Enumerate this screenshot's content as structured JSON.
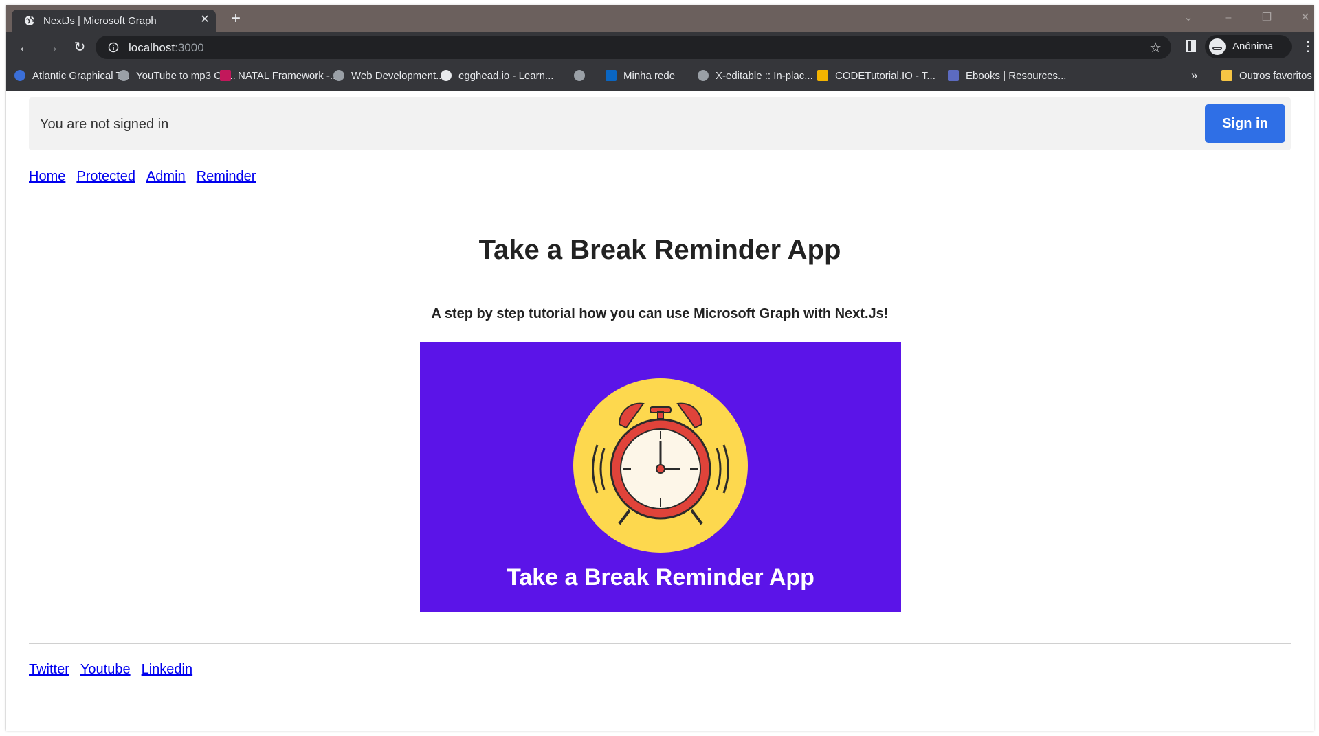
{
  "browser": {
    "tab": {
      "title": "NextJs | Microsoft Graph"
    },
    "omnibox": {
      "host": "localhost",
      "port": ":3000"
    },
    "profile": {
      "label": "Anônima"
    },
    "bookmarks": [
      "Atlantic Graphical T...",
      "YouTube to mp3 Co...",
      "NATAL Framework -...",
      "Web Development...",
      "egghead.io - Learn...",
      "",
      "Minha rede",
      "X-editable :: In-plac...",
      "CODETutorial.IO - T...",
      "Ebooks | Resources..."
    ],
    "bookmarks_overflow": "»",
    "other_bookmarks": "Outros favoritos"
  },
  "page": {
    "signin_bar": {
      "message": "You are not signed in",
      "button": "Sign in"
    },
    "nav": [
      "Home",
      "Protected",
      "Admin",
      "Reminder"
    ],
    "title": "Take a Break Reminder App",
    "subtitle": "A step by step tutorial how you can use Microsoft Graph with Next.Js!",
    "hero": {
      "caption": "Take a Break Reminder App",
      "bg_color": "#5b14e8",
      "circle_color": "#fdd84e",
      "clock_color": "#e0433a"
    },
    "footer_links": [
      "Twitter",
      "Youtube",
      "Linkedin"
    ]
  }
}
